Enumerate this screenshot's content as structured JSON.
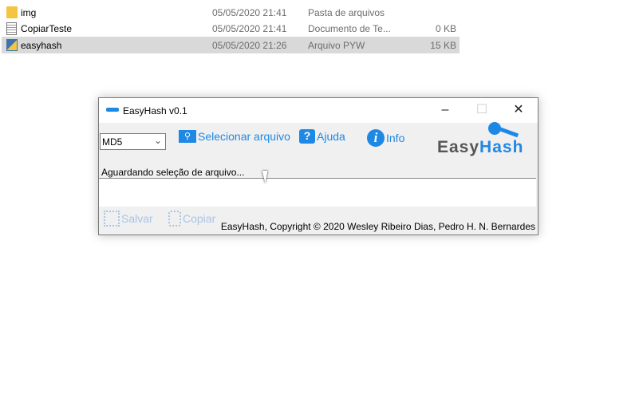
{
  "explorer": {
    "rows": [
      {
        "name": "img",
        "date": "05/05/2020 21:41",
        "type": "Pasta de arquivos",
        "size": ""
      },
      {
        "name": "CopiarTeste",
        "date": "05/05/2020 21:41",
        "type": "Documento de Te...",
        "size": "0 KB"
      },
      {
        "name": "easyhash",
        "date": "05/05/2020 21:26",
        "type": "Arquivo PYW",
        "size": "15 KB"
      }
    ]
  },
  "window": {
    "title": "EasyHash v0.1",
    "algorithm": "MD5",
    "select_file": "Selecionar arquivo",
    "help": "Ajuda",
    "info": "Info",
    "logo": "EasyHash",
    "status": "Aguardando seleção de arquivo...",
    "output": "",
    "save": "Salvar",
    "copy": "Copiar",
    "copyright": "EasyHash, Copyright © 2020 Wesley Ribeiro Dias, Pedro H. N. Bernardes"
  },
  "colors": {
    "accent": "#1e88e5",
    "selected_row": "#d9d9d9"
  }
}
